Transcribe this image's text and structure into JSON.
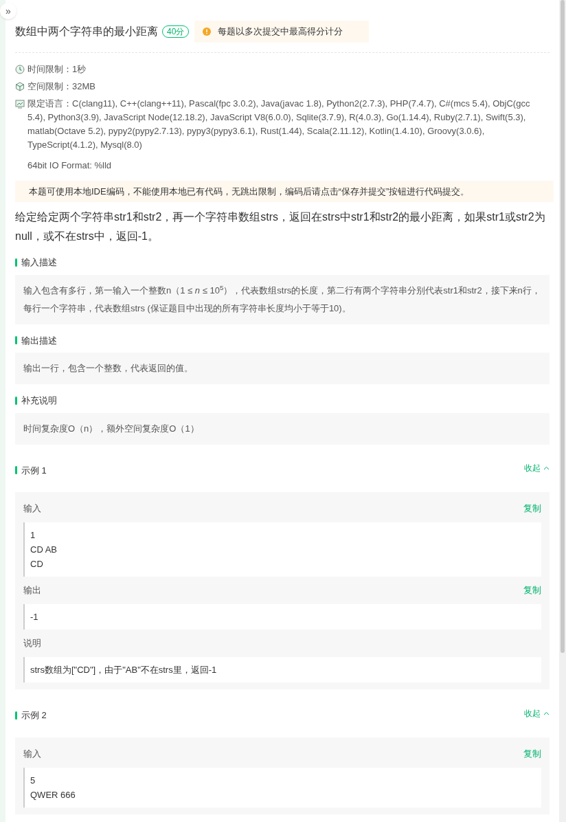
{
  "sidebar_toggle": {
    "label": "»"
  },
  "problem": {
    "title": "数组中两个字符串的最小距离",
    "score": "40分",
    "notice": "每题以多次提交中最高得分计分"
  },
  "limits": [
    {
      "kind": "clock",
      "label": "时间限制：",
      "value": "1秒"
    },
    {
      "kind": "cube",
      "label": "空间限制：",
      "value": "32MB"
    },
    {
      "kind": "code",
      "label": "限定语言：",
      "value": "C(clang11), C++(clang++11), Pascal(fpc 3.0.2), Java(javac 1.8), Python2(2.7.3), PHP(7.4.7), C#(mcs 5.4), ObjC(gcc 5.4), Python3(3.9), JavaScript Node(12.18.2), JavaScript V8(6.0.0), Sqlite(3.7.9), R(4.0.3), Go(1.14.4), Ruby(2.7.1), Swift(5.3), matlab(Octave 5.2), pypy2(pypy2.7.13), pypy3(pypy3.6.1), Rust(1.44), Scala(2.11.12), Kotlin(1.4.10), Groovy(3.0.6), TypeScript(4.1.2), Mysql(8.0)"
    }
  ],
  "io_format": "64bit IO Format: %lld",
  "ide_notice": "本题可使用本地IDE编码，不能使用本地已有代码，无跳出限制，编码后请点击“保存并提交”按钮进行代码提交。",
  "description": "给定给定两个字符串str1和str2，再一个字符串数组strs，返回在strs中str1和str2的最小距离，如果str1或str2为null，或不在strs中，返回-1。",
  "sections": [
    {
      "title": "输入描述",
      "text": "输入包含有多行，第一输入一个整数n（1 ≤ *n* ≤ 10$^{5}$），代表数组strs的长度，第二行有两个字符串分别代表str1和str2，接下来n行，每行一个字符串，代表数组strs (保证题目中出现的所有字符串长度均小于等于10)。"
    },
    {
      "title": "输出描述",
      "text": "输出一行，包含一个整数，代表返回的值。"
    },
    {
      "title": "补充说明",
      "text": "时间复杂度O（n），额外空间复杂度O（1）"
    }
  ],
  "examples": [
    {
      "title": "示例 1",
      "toggle": "收起",
      "expanded": true,
      "blocks": [
        {
          "label": "输入",
          "copy": "复制",
          "lines": [
            "1",
            "CD AB",
            "CD"
          ]
        },
        {
          "label": "输出",
          "copy": "复制",
          "lines": [
            "-1"
          ]
        },
        {
          "label": "说明",
          "lines": [
            "strs数组为[\"CD\"]，由于\"AB\"不在strs里，返回-1"
          ]
        }
      ]
    },
    {
      "title": "示例 2",
      "toggle": "收起",
      "expanded": true,
      "blocks": [
        {
          "label": "输入",
          "copy": "复制",
          "lines": [
            "5",
            "QWER 666"
          ]
        }
      ]
    }
  ]
}
